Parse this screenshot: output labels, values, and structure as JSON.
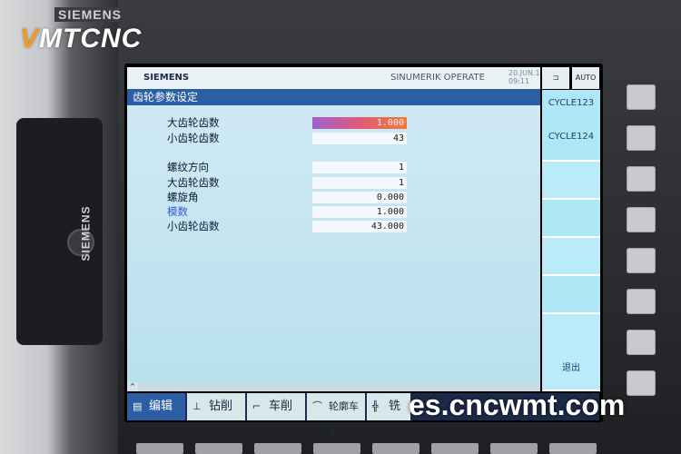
{
  "branding": {
    "frame_brand": "SIEMENS",
    "logo_left": "V",
    "logo_rest": "MTCNC",
    "watermark_url": "es.cncwmt.com"
  },
  "titlebar": {
    "brand": "SIEMENS",
    "product": "SINUMERIK OPERATE",
    "date": "20.JUN.1",
    "time": "09:11"
  },
  "top_icons": {
    "left": "⊐",
    "right": "AUTO"
  },
  "header": {
    "title": "齿轮参数设定"
  },
  "params": [
    {
      "label": "大齿轮齿数",
      "value": "1.000",
      "active": true
    },
    {
      "label": "小齿轮齿数",
      "value": "43"
    },
    {
      "label": "螺纹方向",
      "value": "1"
    },
    {
      "label": "大齿轮齿数",
      "value": "1"
    },
    {
      "label": "螺旋角",
      "value": "0.000"
    },
    {
      "label": "模数",
      "value": "1.000",
      "highlight": true
    },
    {
      "label": "小齿轮齿数",
      "value": "43.000"
    }
  ],
  "softkeys": [
    "CYCLE123",
    "",
    "CYCLE124",
    "",
    "",
    "",
    "",
    "退出"
  ],
  "hkeys": [
    {
      "label": "编辑",
      "active": true
    },
    {
      "label": "钻削"
    },
    {
      "label": "车削"
    },
    {
      "label": "轮廓车削"
    },
    {
      "label": "铣"
    }
  ],
  "scroll_arrow": "^"
}
